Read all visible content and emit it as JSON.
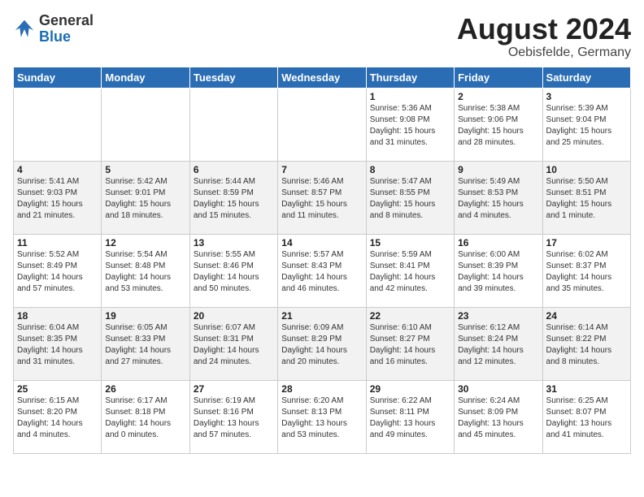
{
  "logo": {
    "general": "General",
    "blue": "Blue"
  },
  "header": {
    "month_year": "August 2024",
    "location": "Oebisfelde, Germany"
  },
  "weekdays": [
    "Sunday",
    "Monday",
    "Tuesday",
    "Wednesday",
    "Thursday",
    "Friday",
    "Saturday"
  ],
  "weeks": [
    [
      {
        "day": "",
        "info": ""
      },
      {
        "day": "",
        "info": ""
      },
      {
        "day": "",
        "info": ""
      },
      {
        "day": "",
        "info": ""
      },
      {
        "day": "1",
        "info": "Sunrise: 5:36 AM\nSunset: 9:08 PM\nDaylight: 15 hours\nand 31 minutes."
      },
      {
        "day": "2",
        "info": "Sunrise: 5:38 AM\nSunset: 9:06 PM\nDaylight: 15 hours\nand 28 minutes."
      },
      {
        "day": "3",
        "info": "Sunrise: 5:39 AM\nSunset: 9:04 PM\nDaylight: 15 hours\nand 25 minutes."
      }
    ],
    [
      {
        "day": "4",
        "info": "Sunrise: 5:41 AM\nSunset: 9:03 PM\nDaylight: 15 hours\nand 21 minutes."
      },
      {
        "day": "5",
        "info": "Sunrise: 5:42 AM\nSunset: 9:01 PM\nDaylight: 15 hours\nand 18 minutes."
      },
      {
        "day": "6",
        "info": "Sunrise: 5:44 AM\nSunset: 8:59 PM\nDaylight: 15 hours\nand 15 minutes."
      },
      {
        "day": "7",
        "info": "Sunrise: 5:46 AM\nSunset: 8:57 PM\nDaylight: 15 hours\nand 11 minutes."
      },
      {
        "day": "8",
        "info": "Sunrise: 5:47 AM\nSunset: 8:55 PM\nDaylight: 15 hours\nand 8 minutes."
      },
      {
        "day": "9",
        "info": "Sunrise: 5:49 AM\nSunset: 8:53 PM\nDaylight: 15 hours\nand 4 minutes."
      },
      {
        "day": "10",
        "info": "Sunrise: 5:50 AM\nSunset: 8:51 PM\nDaylight: 15 hours\nand 1 minute."
      }
    ],
    [
      {
        "day": "11",
        "info": "Sunrise: 5:52 AM\nSunset: 8:49 PM\nDaylight: 14 hours\nand 57 minutes."
      },
      {
        "day": "12",
        "info": "Sunrise: 5:54 AM\nSunset: 8:48 PM\nDaylight: 14 hours\nand 53 minutes."
      },
      {
        "day": "13",
        "info": "Sunrise: 5:55 AM\nSunset: 8:46 PM\nDaylight: 14 hours\nand 50 minutes."
      },
      {
        "day": "14",
        "info": "Sunrise: 5:57 AM\nSunset: 8:43 PM\nDaylight: 14 hours\nand 46 minutes."
      },
      {
        "day": "15",
        "info": "Sunrise: 5:59 AM\nSunset: 8:41 PM\nDaylight: 14 hours\nand 42 minutes."
      },
      {
        "day": "16",
        "info": "Sunrise: 6:00 AM\nSunset: 8:39 PM\nDaylight: 14 hours\nand 39 minutes."
      },
      {
        "day": "17",
        "info": "Sunrise: 6:02 AM\nSunset: 8:37 PM\nDaylight: 14 hours\nand 35 minutes."
      }
    ],
    [
      {
        "day": "18",
        "info": "Sunrise: 6:04 AM\nSunset: 8:35 PM\nDaylight: 14 hours\nand 31 minutes."
      },
      {
        "day": "19",
        "info": "Sunrise: 6:05 AM\nSunset: 8:33 PM\nDaylight: 14 hours\nand 27 minutes."
      },
      {
        "day": "20",
        "info": "Sunrise: 6:07 AM\nSunset: 8:31 PM\nDaylight: 14 hours\nand 24 minutes."
      },
      {
        "day": "21",
        "info": "Sunrise: 6:09 AM\nSunset: 8:29 PM\nDaylight: 14 hours\nand 20 minutes."
      },
      {
        "day": "22",
        "info": "Sunrise: 6:10 AM\nSunset: 8:27 PM\nDaylight: 14 hours\nand 16 minutes."
      },
      {
        "day": "23",
        "info": "Sunrise: 6:12 AM\nSunset: 8:24 PM\nDaylight: 14 hours\nand 12 minutes."
      },
      {
        "day": "24",
        "info": "Sunrise: 6:14 AM\nSunset: 8:22 PM\nDaylight: 14 hours\nand 8 minutes."
      }
    ],
    [
      {
        "day": "25",
        "info": "Sunrise: 6:15 AM\nSunset: 8:20 PM\nDaylight: 14 hours\nand 4 minutes."
      },
      {
        "day": "26",
        "info": "Sunrise: 6:17 AM\nSunset: 8:18 PM\nDaylight: 14 hours\nand 0 minutes."
      },
      {
        "day": "27",
        "info": "Sunrise: 6:19 AM\nSunset: 8:16 PM\nDaylight: 13 hours\nand 57 minutes."
      },
      {
        "day": "28",
        "info": "Sunrise: 6:20 AM\nSunset: 8:13 PM\nDaylight: 13 hours\nand 53 minutes."
      },
      {
        "day": "29",
        "info": "Sunrise: 6:22 AM\nSunset: 8:11 PM\nDaylight: 13 hours\nand 49 minutes."
      },
      {
        "day": "30",
        "info": "Sunrise: 6:24 AM\nSunset: 8:09 PM\nDaylight: 13 hours\nand 45 minutes."
      },
      {
        "day": "31",
        "info": "Sunrise: 6:25 AM\nSunset: 8:07 PM\nDaylight: 13 hours\nand 41 minutes."
      }
    ]
  ]
}
